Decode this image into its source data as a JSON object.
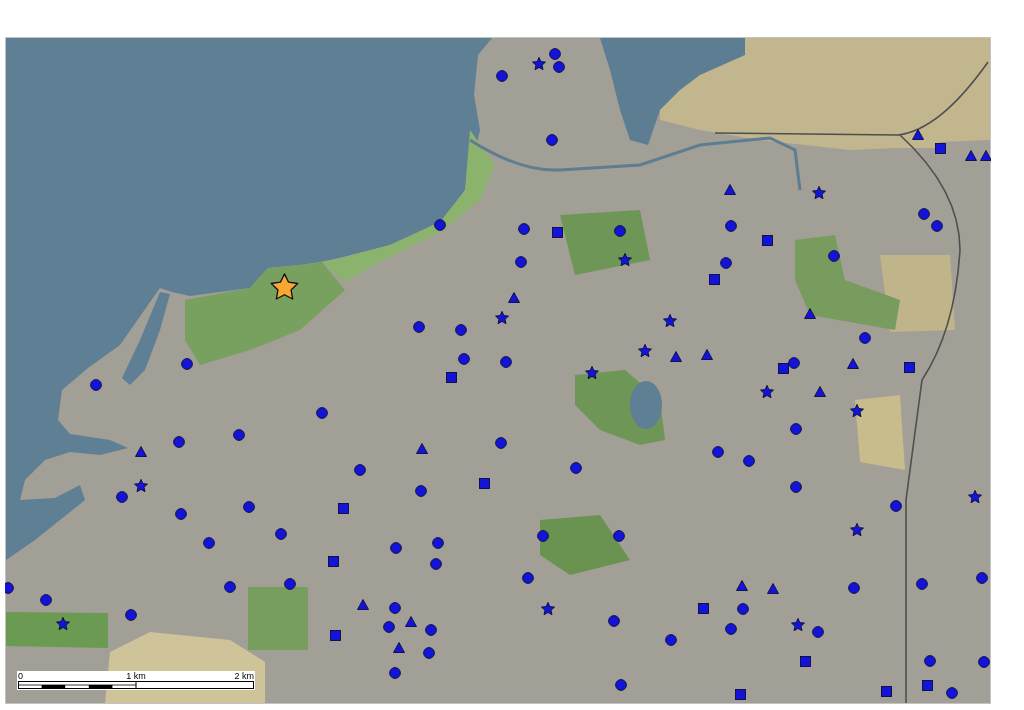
{
  "map": {
    "markers": [
      {
        "kind": "circle",
        "color": "#1414d8"
      },
      {
        "kind": "star",
        "color": "#1414d8"
      },
      {
        "kind": "circle",
        "color": "#1414d8"
      },
      {
        "kind": "circle",
        "color": "#1414d8"
      },
      {
        "kind": "triangle",
        "color": "#1414d8"
      },
      {
        "kind": "circle",
        "color": "#1414d8"
      },
      {
        "kind": "square",
        "color": "#1414d8"
      },
      {
        "kind": "triangle",
        "color": "#1414d8"
      },
      {
        "kind": "triangle",
        "color": "#1414d8"
      },
      {
        "kind": "triangle",
        "color": "#1414d8"
      },
      {
        "kind": "star",
        "color": "#1414d8"
      },
      {
        "kind": "circle",
        "color": "#1414d8"
      },
      {
        "kind": "circle",
        "color": "#1414d8"
      },
      {
        "kind": "circle",
        "color": "#1414d8"
      },
      {
        "kind": "circle",
        "color": "#1414d8"
      },
      {
        "kind": "circle",
        "color": "#1414d8"
      },
      {
        "kind": "circle",
        "color": "#1414d8"
      },
      {
        "kind": "square",
        "color": "#1414d8"
      },
      {
        "kind": "square",
        "color": "#1414d8"
      },
      {
        "kind": "circle",
        "color": "#1414d8"
      },
      {
        "kind": "star",
        "color": "#1414d8"
      },
      {
        "kind": "circle",
        "color": "#1414d8"
      },
      {
        "kind": "circle",
        "color": "#1414d8"
      },
      {
        "kind": "square",
        "color": "#1414d8"
      },
      {
        "kind": "large_star",
        "color": "#f8a832"
      },
      {
        "kind": "triangle",
        "color": "#1414d8"
      },
      {
        "kind": "triangle",
        "color": "#1414d8"
      },
      {
        "kind": "star",
        "color": "#1414d8"
      },
      {
        "kind": "star",
        "color": "#1414d8"
      },
      {
        "kind": "circle",
        "color": "#1414d8"
      },
      {
        "kind": "circle",
        "color": "#1414d8"
      },
      {
        "kind": "circle",
        "color": "#1414d8"
      },
      {
        "kind": "star",
        "color": "#1414d8"
      },
      {
        "kind": "triangle",
        "color": "#1414d8"
      },
      {
        "kind": "triangle",
        "color": "#1414d8"
      },
      {
        "kind": "circle",
        "color": "#1414d8"
      },
      {
        "kind": "circle",
        "color": "#1414d8"
      },
      {
        "kind": "circle",
        "color": "#1414d8"
      },
      {
        "kind": "triangle",
        "color": "#1414d8"
      },
      {
        "kind": "circle",
        "color": "#1414d8"
      },
      {
        "kind": "square",
        "color": "#1414d8"
      },
      {
        "kind": "square",
        "color": "#1414d8"
      },
      {
        "kind": "star",
        "color": "#1414d8"
      },
      {
        "kind": "square",
        "color": "#1414d8"
      },
      {
        "kind": "circle",
        "color": "#1414d8"
      },
      {
        "kind": "star",
        "color": "#1414d8"
      },
      {
        "kind": "triangle",
        "color": "#1414d8"
      },
      {
        "kind": "star",
        "color": "#1414d8"
      },
      {
        "kind": "circle",
        "color": "#1414d8"
      },
      {
        "kind": "circle",
        "color": "#1414d8"
      },
      {
        "kind": "circle",
        "color": "#1414d8"
      },
      {
        "kind": "circle",
        "color": "#1414d8"
      },
      {
        "kind": "circle",
        "color": "#1414d8"
      },
      {
        "kind": "triangle",
        "color": "#1414d8"
      },
      {
        "kind": "triangle",
        "color": "#1414d8"
      },
      {
        "kind": "circle",
        "color": "#1414d8"
      },
      {
        "kind": "circle",
        "color": "#1414d8"
      },
      {
        "kind": "circle",
        "color": "#1414d8"
      },
      {
        "kind": "circle",
        "color": "#1414d8"
      },
      {
        "kind": "square",
        "color": "#1414d8"
      },
      {
        "kind": "star",
        "color": "#1414d8"
      },
      {
        "kind": "circle",
        "color": "#1414d8"
      },
      {
        "kind": "circle",
        "color": "#1414d8"
      },
      {
        "kind": "star",
        "color": "#1414d8"
      },
      {
        "kind": "circle",
        "color": "#1414d8"
      },
      {
        "kind": "circle",
        "color": "#1414d8"
      },
      {
        "kind": "circle",
        "color": "#1414d8"
      },
      {
        "kind": "square",
        "color": "#1414d8"
      },
      {
        "kind": "circle",
        "color": "#1414d8"
      },
      {
        "kind": "star",
        "color": "#1414d8"
      },
      {
        "kind": "circle",
        "color": "#1414d8"
      },
      {
        "kind": "circle",
        "color": "#1414d8"
      },
      {
        "kind": "circle",
        "color": "#1414d8"
      },
      {
        "kind": "circle",
        "color": "#1414d8"
      },
      {
        "kind": "circle",
        "color": "#1414d8"
      },
      {
        "kind": "circle",
        "color": "#1414d8"
      },
      {
        "kind": "square",
        "color": "#1414d8"
      },
      {
        "kind": "circle",
        "color": "#1414d8"
      },
      {
        "kind": "circle",
        "color": "#1414d8"
      },
      {
        "kind": "circle",
        "color": "#1414d8"
      },
      {
        "kind": "circle",
        "color": "#1414d8"
      },
      {
        "kind": "circle",
        "color": "#1414d8"
      },
      {
        "kind": "triangle",
        "color": "#1414d8"
      },
      {
        "kind": "circle",
        "color": "#1414d8"
      },
      {
        "kind": "circle",
        "color": "#1414d8"
      },
      {
        "kind": "triangle",
        "color": "#1414d8"
      },
      {
        "kind": "circle",
        "color": "#1414d8"
      },
      {
        "kind": "circle",
        "color": "#1414d8"
      },
      {
        "kind": "triangle",
        "color": "#1414d8"
      },
      {
        "kind": "star",
        "color": "#1414d8"
      },
      {
        "kind": "circle",
        "color": "#1414d8"
      },
      {
        "kind": "square",
        "color": "#1414d8"
      },
      {
        "kind": "circle",
        "color": "#1414d8"
      },
      {
        "kind": "circle",
        "color": "#1414d8"
      },
      {
        "kind": "triangle",
        "color": "#1414d8"
      },
      {
        "kind": "circle",
        "color": "#1414d8"
      },
      {
        "kind": "star",
        "color": "#1414d8"
      },
      {
        "kind": "star",
        "color": "#1414d8"
      },
      {
        "kind": "circle",
        "color": "#1414d8"
      },
      {
        "kind": "circle",
        "color": "#1414d8"
      },
      {
        "kind": "circle",
        "color": "#1414d8"
      },
      {
        "kind": "circle",
        "color": "#1414d8"
      },
      {
        "kind": "square",
        "color": "#1414d8"
      },
      {
        "kind": "circle",
        "color": "#1414d8"
      },
      {
        "kind": "triangle",
        "color": "#1414d8"
      },
      {
        "kind": "circle",
        "color": "#1414d8"
      },
      {
        "kind": "square",
        "color": "#1414d8"
      },
      {
        "kind": "circle",
        "color": "#1414d8"
      },
      {
        "kind": "circle",
        "color": "#1414d8"
      },
      {
        "kind": "circle",
        "color": "#1414d8"
      },
      {
        "kind": "circle",
        "color": "#1414d8"
      },
      {
        "kind": "square",
        "color": "#1414d8"
      },
      {
        "kind": "square",
        "color": "#1414d8"
      },
      {
        "kind": "circle",
        "color": "#1414d8"
      },
      {
        "kind": "square",
        "color": "#1414d8"
      }
    ],
    "scale_bar": {
      "labels": [
        "0",
        "1 km",
        "2 km"
      ]
    }
  }
}
